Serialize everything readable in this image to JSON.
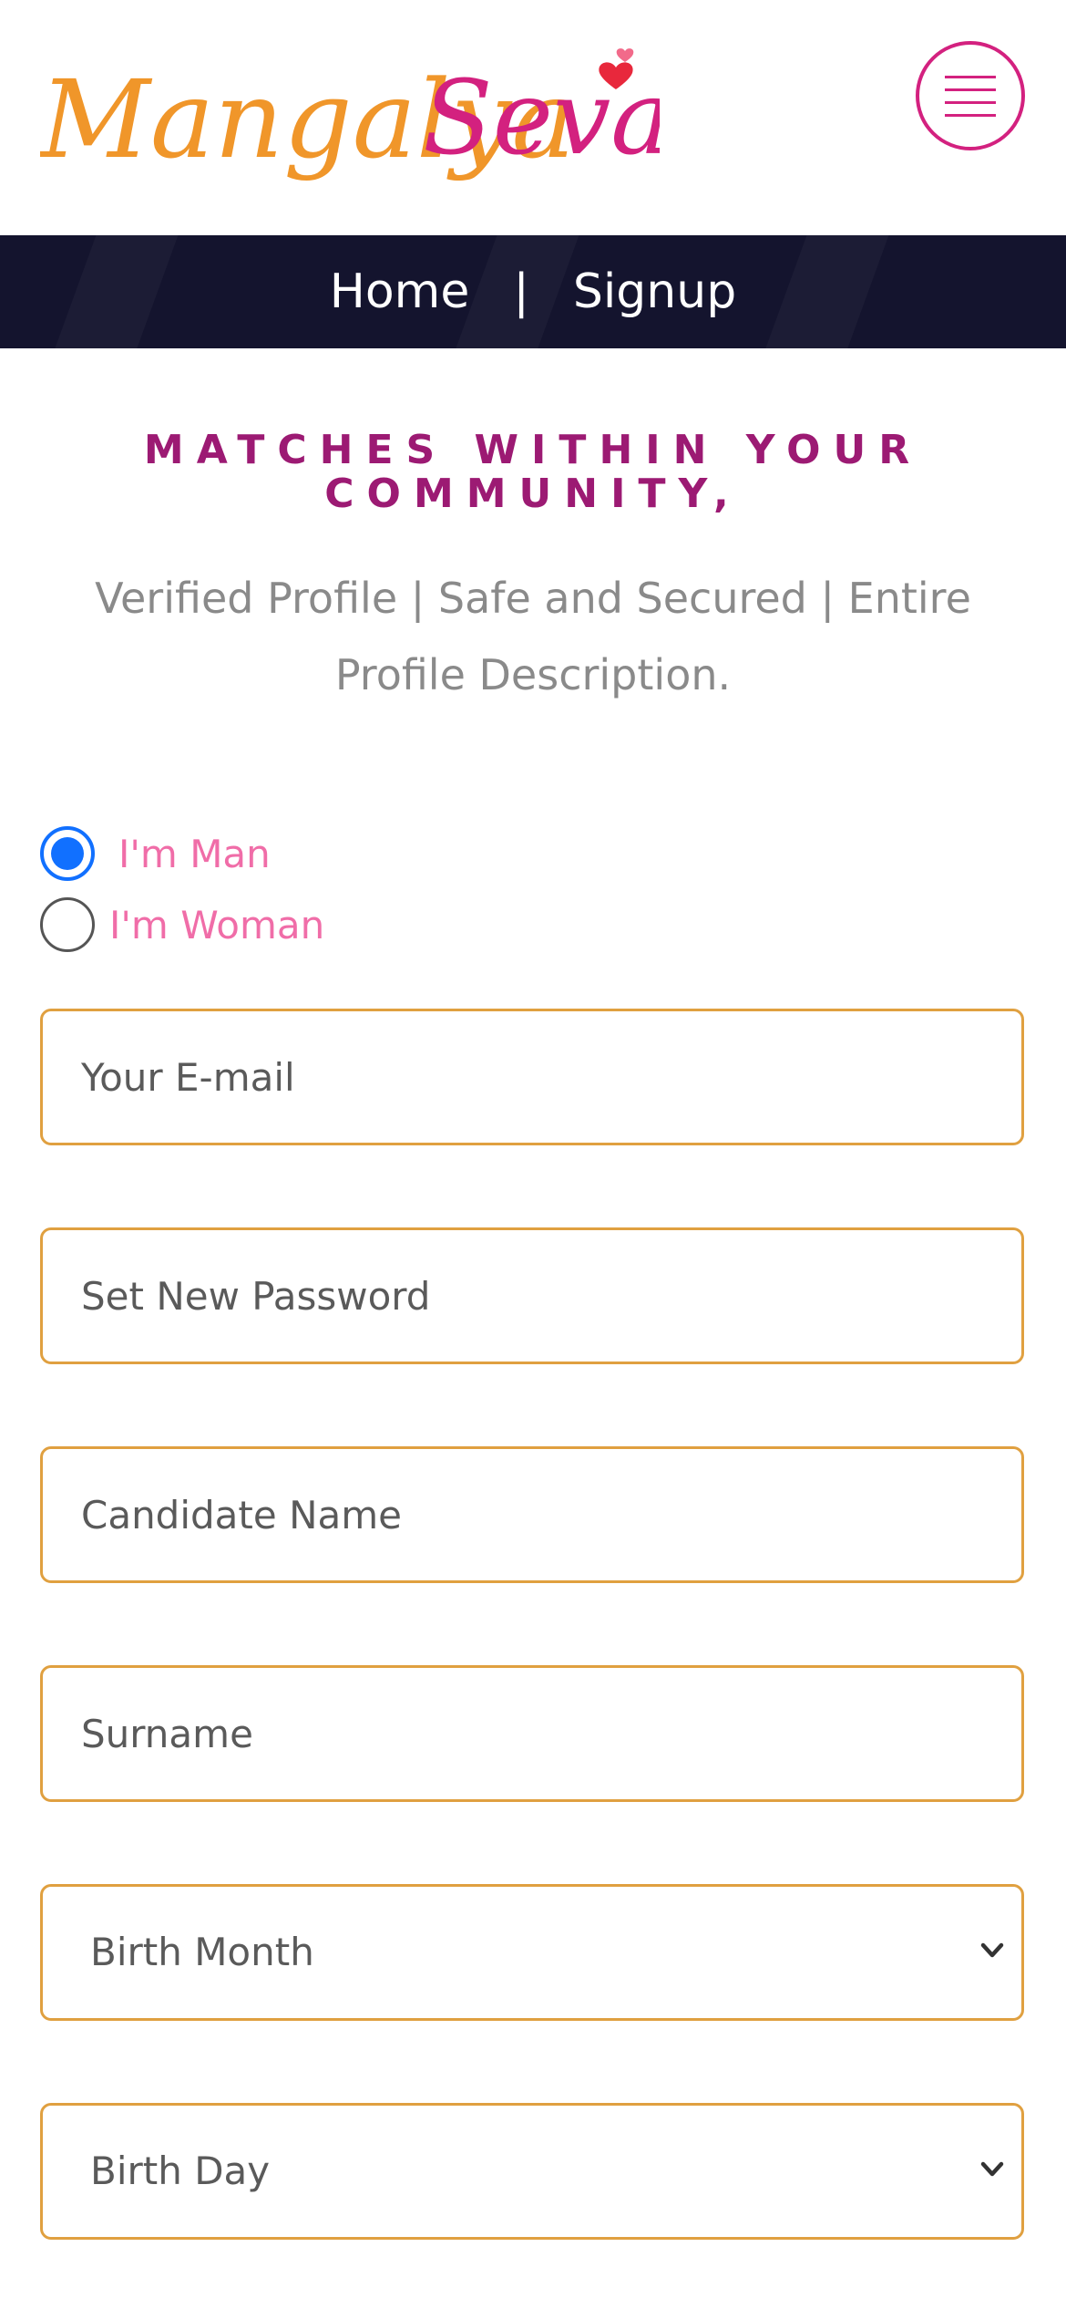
{
  "brand": {
    "logo_text_1": "Mangalya",
    "logo_text_2": "Sevai"
  },
  "nav": {
    "home": "Home",
    "separator": "|",
    "signup": "Signup"
  },
  "hero": {
    "tagline_line1": "MATCHES WITHIN YOUR",
    "tagline_line2": "COMMUNITY,",
    "subline_line1": "Verified Profile | Safe and Secured | Entire",
    "subline_line2": "Profile Description."
  },
  "gender": {
    "options": [
      {
        "label": "I'm Man",
        "selected": true
      },
      {
        "label": "I'm Woman",
        "selected": false
      }
    ]
  },
  "form": {
    "email_placeholder": "Your E-mail",
    "password_placeholder": "Set New Password",
    "name_placeholder": "Candidate Name",
    "surname_placeholder": "Surname",
    "birth_month": "Birth Month",
    "birth_day": "Birth Day"
  },
  "icons": {
    "menu": "hamburger-menu-icon",
    "select": "chevron-down-icon",
    "logo_heart": "heart-icon"
  },
  "colors": {
    "brand_orange": "#f0962a",
    "brand_pink": "#d3217f",
    "navbar_bg": "#14142e",
    "tagline": "#9c1a73",
    "field_border": "#e0a040",
    "radio_selected": "#1170ff",
    "radio_label": "#f06da8"
  }
}
